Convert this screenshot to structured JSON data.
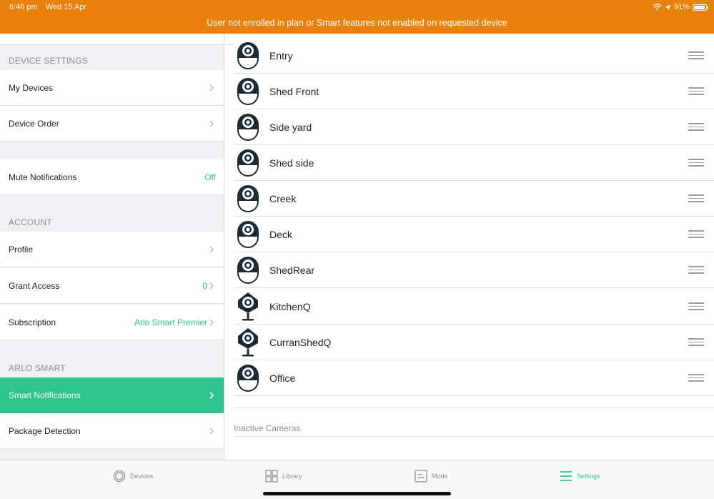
{
  "status": {
    "time": "6:46 pm",
    "date": "Wed 15 Apr",
    "battery": "91%"
  },
  "banner": {
    "message": "User not enrolled in plan or Smart features not enabled on requested device",
    "color": "#E8820C"
  },
  "accent": "#2DC48D",
  "sidebar": {
    "sections": {
      "device_settings": "DEVICE SETTINGS",
      "account": "ACCOUNT",
      "arlo_smart": "ARLO SMART"
    },
    "items": {
      "my_devices": {
        "label": "My Devices"
      },
      "device_order": {
        "label": "Device Order"
      },
      "mute_notifications": {
        "label": "Mute Notifications",
        "value": "Off"
      },
      "profile": {
        "label": "Profile"
      },
      "grant_access": {
        "label": "Grant Access",
        "value": "0"
      },
      "subscription": {
        "label": "Subscription",
        "value": "Arlo Smart Premier"
      },
      "smart_notifications": {
        "label": "Smart Notifications"
      },
      "package_detection": {
        "label": "Package Detection"
      }
    }
  },
  "devices": [
    {
      "name": "Entry",
      "icon": "camera-icon"
    },
    {
      "name": "Shed Front",
      "icon": "camera-icon"
    },
    {
      "name": "Side yard",
      "icon": "camera-icon"
    },
    {
      "name": "Shed side",
      "icon": "camera-icon"
    },
    {
      "name": "Creek",
      "icon": "camera-icon"
    },
    {
      "name": "Deck",
      "icon": "camera-icon"
    },
    {
      "name": "ShedRear",
      "icon": "camera-icon"
    },
    {
      "name": "KitchenQ",
      "icon": "camera-q-icon"
    },
    {
      "name": "CurranShedQ",
      "icon": "camera-q-icon"
    },
    {
      "name": "Office",
      "icon": "camera-icon"
    }
  ],
  "inactive_label": "Inactive Cameras",
  "tabs": {
    "devices": "Devices",
    "library": "Library",
    "mode": "Mode",
    "settings": "Settings"
  }
}
